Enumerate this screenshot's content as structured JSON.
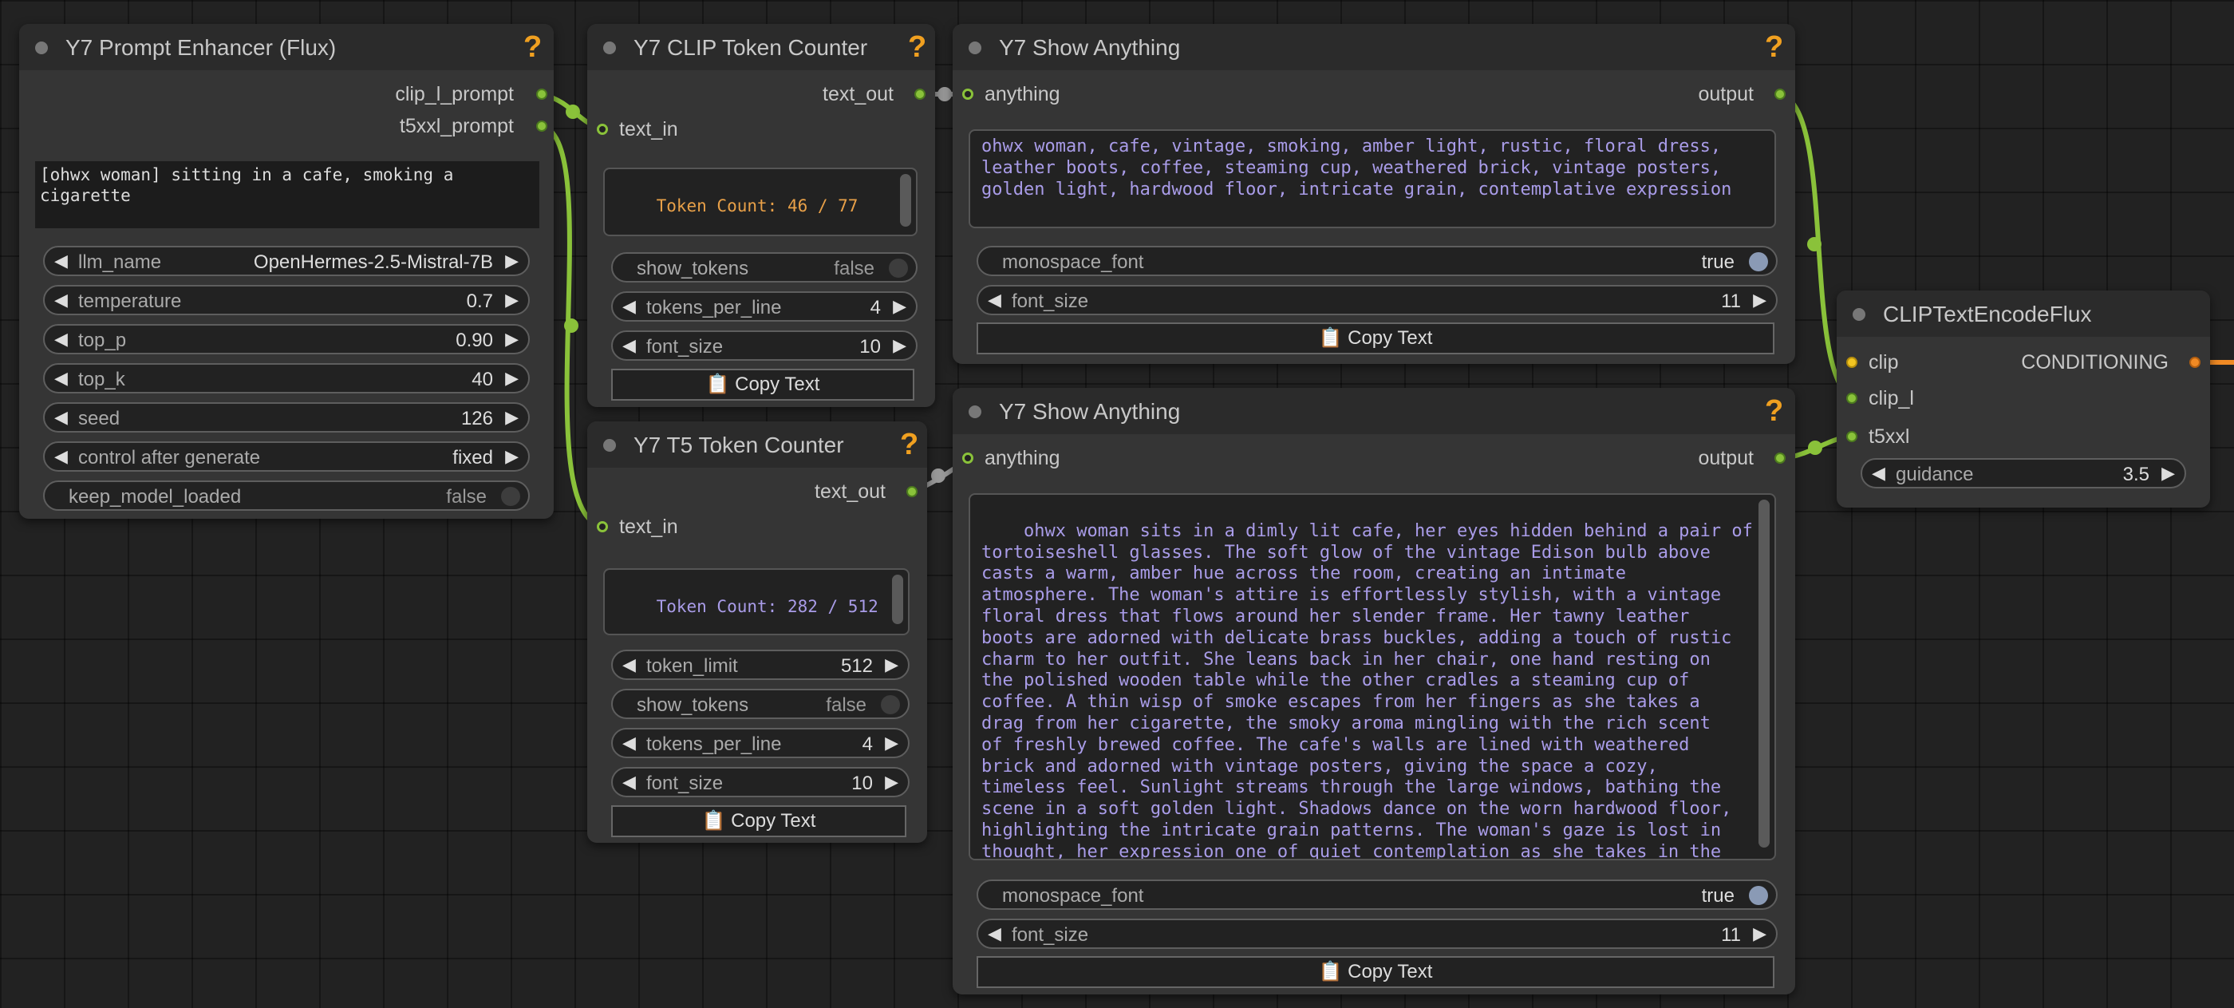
{
  "prompt_enhancer": {
    "title": "Y7 Prompt Enhancer (Flux)",
    "help": "?",
    "outputs": [
      "clip_l_prompt",
      "t5xxl_prompt"
    ],
    "prompt_text": "[ohwx woman] sitting in a cafe, smoking a\ncigarette",
    "widgets": {
      "llm_name": {
        "label": "llm_name",
        "value": "OpenHermes-2.5-Mistral-7B"
      },
      "temperature": {
        "label": "temperature",
        "value": "0.7"
      },
      "top_p": {
        "label": "top_p",
        "value": "0.90"
      },
      "top_k": {
        "label": "top_k",
        "value": "40"
      },
      "seed": {
        "label": "seed",
        "value": "126"
      },
      "control_after_generate": {
        "label": "control after generate",
        "value": "fixed"
      },
      "keep_model_loaded": {
        "label": "keep_model_loaded",
        "value": "false"
      }
    }
  },
  "clip_counter": {
    "title": "Y7 CLIP Token Counter",
    "help": "?",
    "output": "text_out",
    "input": "text_in",
    "token_text": "Token Count: 46 / 77",
    "widgets": {
      "show_tokens": {
        "label": "show_tokens",
        "value": "false"
      },
      "tokens_per_line": {
        "label": "tokens_per_line",
        "value": "4"
      },
      "font_size": {
        "label": "font_size",
        "value": "10"
      }
    },
    "copy_label": "📋 Copy Text"
  },
  "t5_counter": {
    "title": "Y7 T5 Token Counter",
    "help": "?",
    "output": "text_out",
    "input": "text_in",
    "token_text": "Token Count: 282 / 512",
    "widgets": {
      "token_limit": {
        "label": "token_limit",
        "value": "512"
      },
      "show_tokens": {
        "label": "show_tokens",
        "value": "false"
      },
      "tokens_per_line": {
        "label": "tokens_per_line",
        "value": "4"
      },
      "font_size": {
        "label": "font_size",
        "value": "10"
      }
    },
    "copy_label": "📋 Copy Text"
  },
  "show_anything_1": {
    "title": "Y7 Show Anything",
    "help": "?",
    "input": "anything",
    "output": "output",
    "text": "ohwx woman, cafe, vintage, smoking, amber light, rustic, floral dress,\nleather boots, coffee, steaming cup, weathered brick, vintage posters,\ngolden light, hardwood floor, intricate grain, contemplative expression",
    "widgets": {
      "monospace_font": {
        "label": "monospace_font",
        "value": "true"
      },
      "font_size": {
        "label": "font_size",
        "value": "11"
      }
    },
    "copy_label": "📋 Copy Text"
  },
  "show_anything_2": {
    "title": "Y7 Show Anything",
    "help": "?",
    "input": "anything",
    "output": "output",
    "text": "ohwx woman sits in a dimly lit cafe, her eyes hidden behind a pair of\ntortoiseshell glasses. The soft glow of the vintage Edison bulb above\ncasts a warm, amber hue across the room, creating an intimate\natmosphere. The woman's attire is effortlessly stylish, with a vintage\nfloral dress that flows around her slender frame. Her tawny leather\nboots are adorned with delicate brass buckles, adding a touch of rustic\ncharm to her outfit. She leans back in her chair, one hand resting on\nthe polished wooden table while the other cradles a steaming cup of\ncoffee. A thin wisp of smoke escapes from her fingers as she takes a\ndrag from her cigarette, the smoky aroma mingling with the rich scent\nof freshly brewed coffee. The cafe's walls are lined with weathered\nbrick and adorned with vintage posters, giving the space a cozy,\ntimeless feel. Sunlight streams through the large windows, bathing the\nscene in a soft golden light. Shadows dance on the worn hardwood floor,\nhighlighting the intricate grain patterns. The woman's gaze is lost in\nthought, her expression one of quiet contemplation as she takes in the\nsights and sounds around her.",
    "widgets": {
      "monospace_font": {
        "label": "monospace_font",
        "value": "true"
      },
      "font_size": {
        "label": "font_size",
        "value": "11"
      }
    },
    "copy_label": "📋 Copy Text"
  },
  "clip_encode": {
    "title": "CLIPTextEncodeFlux",
    "inputs": [
      "clip",
      "clip_l",
      "t5xxl"
    ],
    "output": "CONDITIONING",
    "widgets": {
      "guidance": {
        "label": "guidance",
        "value": "3.5"
      }
    }
  },
  "colors": {
    "link_green": "#8ac23a",
    "link_orange": "#f08a24",
    "help": "#f0a020",
    "text_purple": "#a99ce8",
    "token_orange": "#e8a048"
  }
}
